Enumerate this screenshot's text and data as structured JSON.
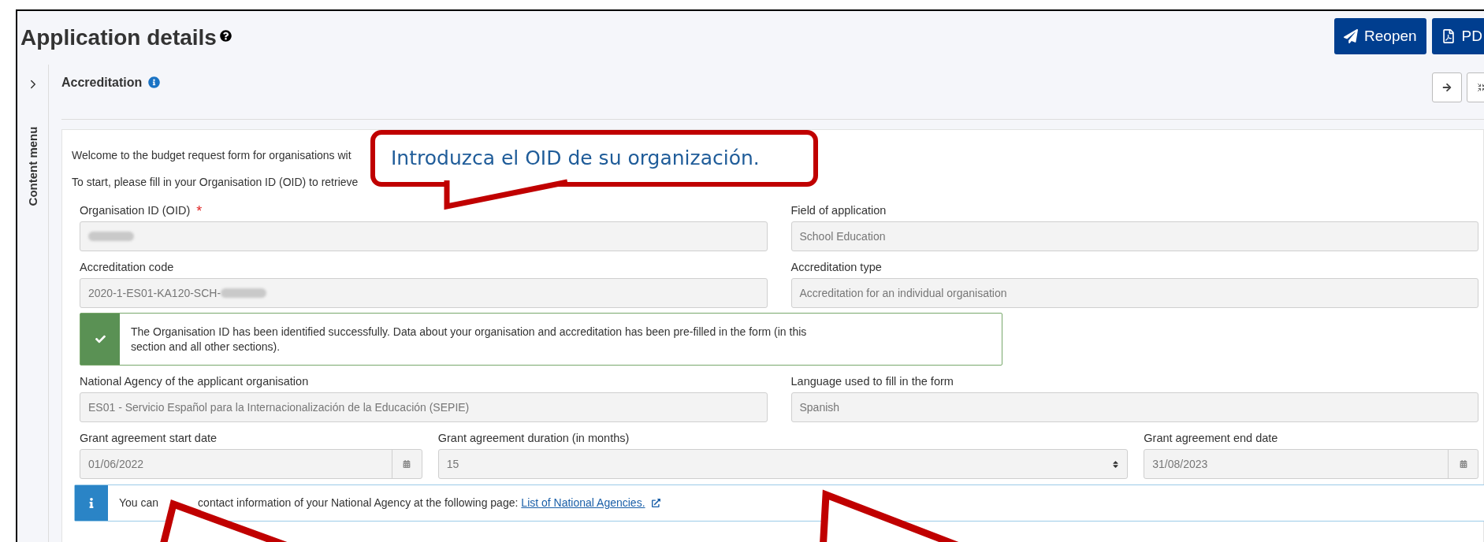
{
  "page": {
    "title": "Application details"
  },
  "toolbar": [
    {
      "kind": "reopen",
      "label": "Reopen"
    },
    {
      "kind": "pdf",
      "label": "PD"
    }
  ],
  "sidebar": {
    "label": "Content menu"
  },
  "section": {
    "title": "Accreditation"
  },
  "intro": [
    "Welcome to the budget request form for organisations wit",
    "To start, please fill in your Organisation ID (OID) to retrieve"
  ],
  "callout": {
    "text": "Introduzca el OID de su organización."
  },
  "form": [
    {
      "kind": "row",
      "fields": [
        {
          "kind": "text",
          "label": "Organisation ID (OID)",
          "marker": "*",
          "redacted": true
        },
        {
          "kind": "text",
          "label": "Field of application",
          "value": "School Education"
        }
      ]
    },
    {
      "kind": "row",
      "fields": [
        {
          "kind": "text",
          "label": "Accreditation code",
          "redacted": true,
          "value": "2020-1-ES01-KA120-SCH-"
        },
        {
          "kind": "text",
          "label": "Accreditation type",
          "value": "Accreditation for an individual organisation"
        }
      ]
    },
    {
      "kind": "success_alert",
      "parts": [
        "The Organisation ID has been identified successfully. Data about your organisation and accreditation has been pre-filled in the form (in this section and all other sections)."
      ]
    },
    {
      "kind": "row",
      "fields": [
        {
          "kind": "text",
          "label": "National Agency of the applicant organisation",
          "value": "ES01 - Servicio Español para la Internacionalización de la Educación (SEPIE)"
        },
        {
          "kind": "text",
          "label": "Language used to fill in the form",
          "value": "Spanish"
        }
      ]
    },
    {
      "kind": "row",
      "fields": [
        {
          "kind": "date",
          "label": "Grant agreement start date",
          "value": "01/06/2022"
        },
        {
          "kind": "select",
          "label": "Grant agreement duration (in months)",
          "value": "15"
        },
        {
          "kind": "date",
          "label": "Grant agreement end date",
          "value": "31/08/2023"
        }
      ]
    },
    {
      "kind": "info_alert",
      "parts": [
        "You can",
        "contact information of your National Agency at the following page:"
      ],
      "link": "List of National Agencies."
    }
  ]
}
